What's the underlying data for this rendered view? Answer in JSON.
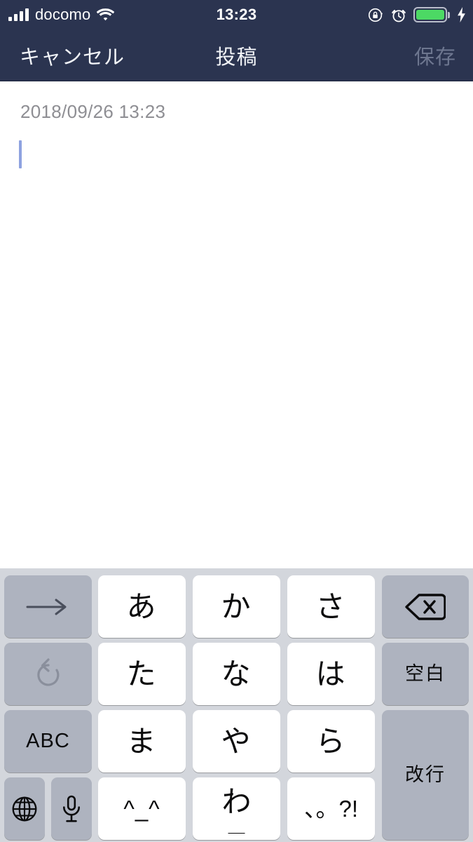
{
  "status_bar": {
    "carrier": "docomo",
    "time": "13:23",
    "signal_icon": "signal-bars-icon",
    "wifi_icon": "wifi-icon",
    "rotation_lock_icon": "rotation-lock-icon",
    "alarm_icon": "alarm-clock-icon",
    "battery_icon": "battery-icon",
    "charging_icon": "lightning-bolt-icon",
    "battery_color": "#4cd964",
    "background_color": "#2b3450"
  },
  "nav_bar": {
    "cancel_label": "キャンセル",
    "title": "投稿",
    "save_label": "保存",
    "save_enabled": false,
    "background_color": "#2b3450",
    "text_color": "#f2f4f8",
    "disabled_text_color": "#6d768f"
  },
  "editor": {
    "date_text": "2018/09/26 13:23",
    "body_text": "",
    "date_color": "#8e8e93",
    "caret_color": "#8ea2e0"
  },
  "keyboard": {
    "background_color": "#d3d6dc",
    "light_key_color": "#ffffff",
    "dark_key_color": "#aeb3bf",
    "keys": {
      "arrow_right": "→",
      "a_row": "あ",
      "ka_row": "か",
      "sa_row": "さ",
      "backspace_icon": "backspace-delete-icon",
      "undo_icon": "undo-arrow-icon",
      "ta_row": "た",
      "na_row": "な",
      "ha_row": "は",
      "space": "空白",
      "abc": "ABC",
      "ma_row": "ま",
      "ya_row": "や",
      "ra_row": "ら",
      "enter": "改行",
      "globe_icon": "globe-language-icon",
      "mic_icon": "microphone-icon",
      "emoticon": "^_^",
      "wa_row": "わ",
      "wa_underscore": "＿",
      "punctuation": "、。?!"
    }
  }
}
